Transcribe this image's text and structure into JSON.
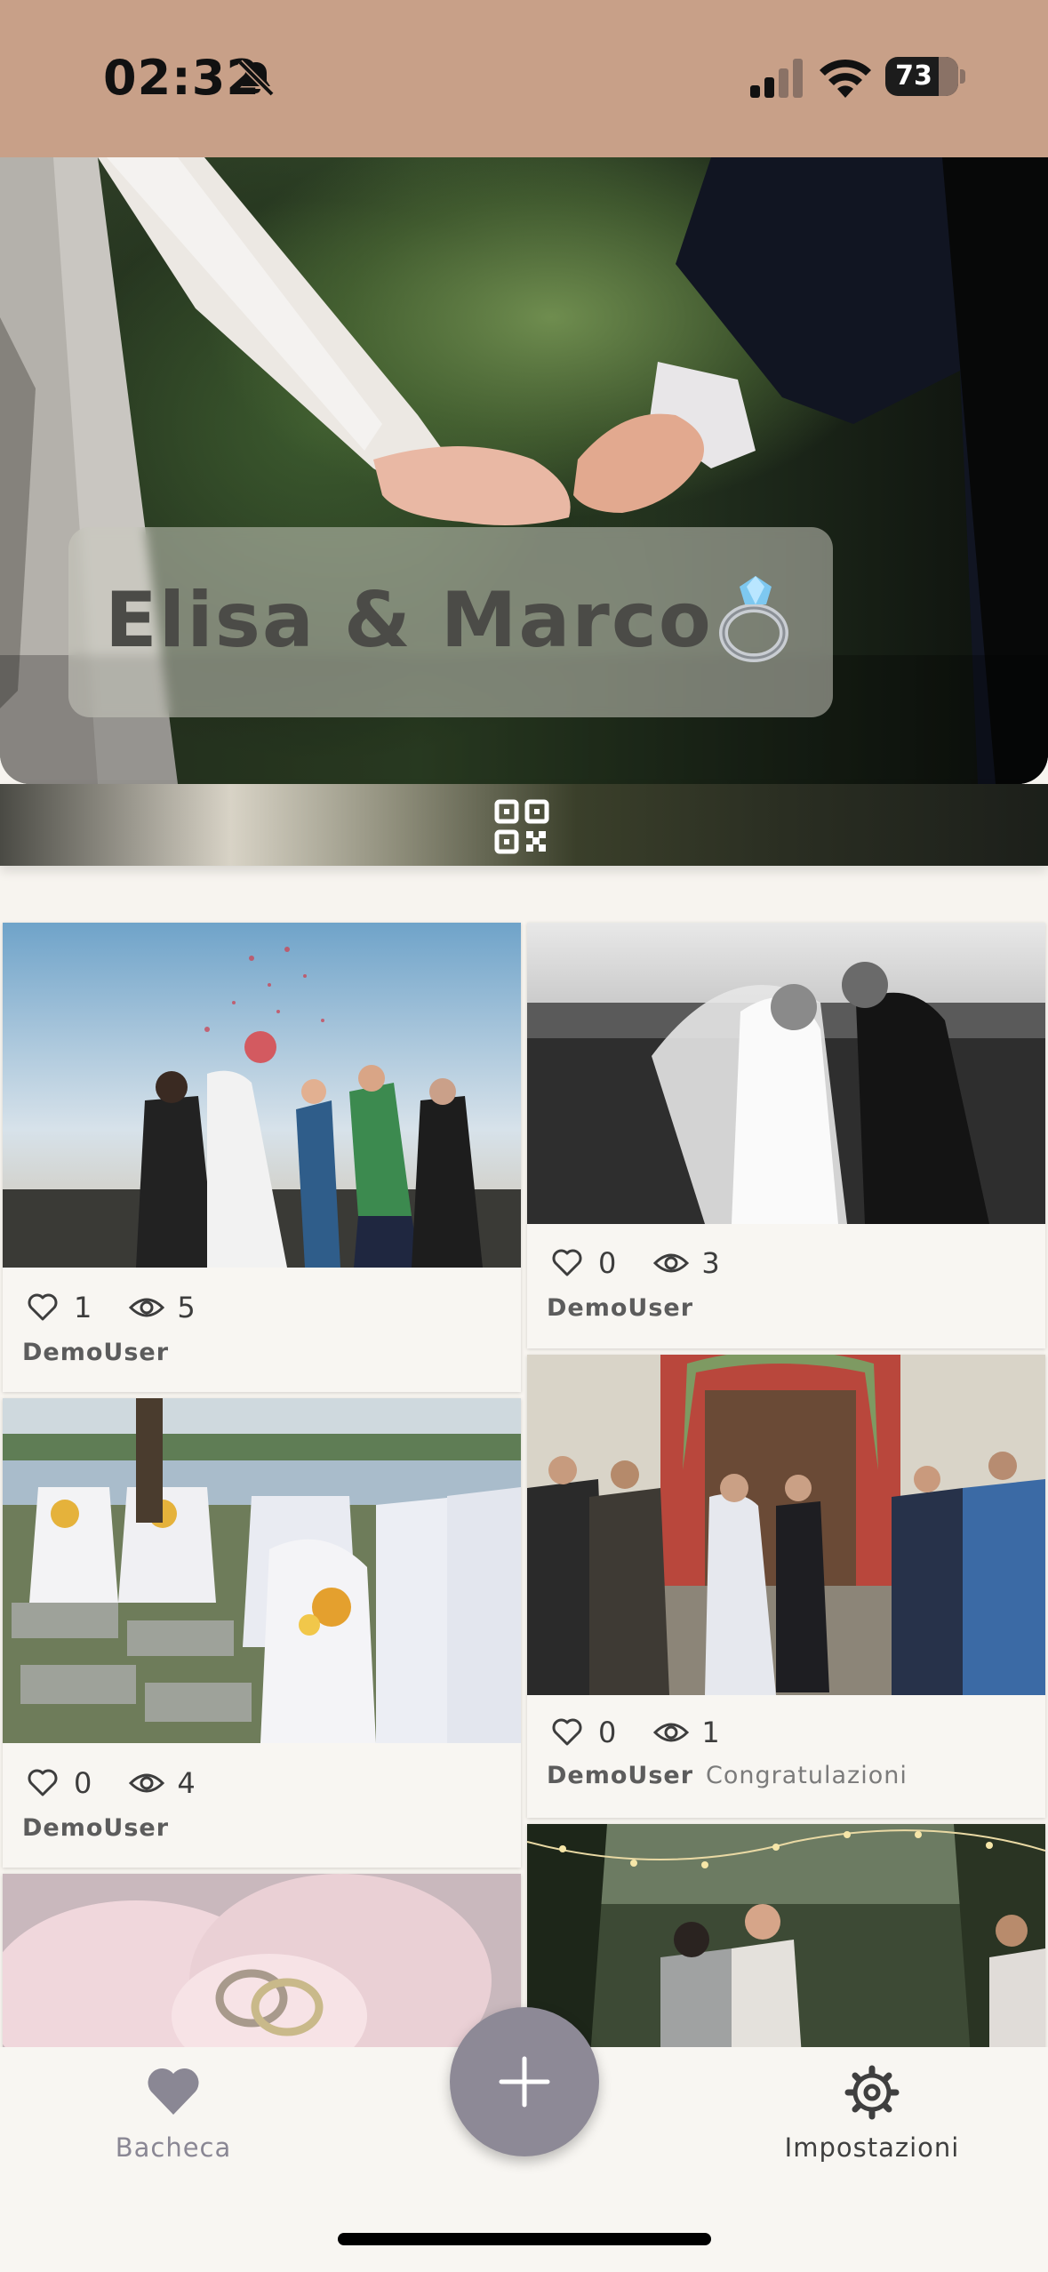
{
  "status_bar": {
    "time": "02:32",
    "battery": "73",
    "battery_level": 0.73,
    "signal_bars": 2
  },
  "header": {
    "couple_names": "Elisa & Marco",
    "title_icon": "ring-icon",
    "qr_icon": "qr-code-icon"
  },
  "posts": [
    {
      "likes": "1",
      "views": "5",
      "author": "DemoUser",
      "caption": ""
    },
    {
      "likes": "0",
      "views": "3",
      "author": "DemoUser",
      "caption": ""
    },
    {
      "likes": "0",
      "views": "4",
      "author": "DemoUser",
      "caption": ""
    },
    {
      "likes": "0",
      "views": "1",
      "author": "DemoUser",
      "caption": "Congratulazioni"
    }
  ],
  "bottom_nav": {
    "feed_label": "Bacheca",
    "feed_icon": "heart-icon",
    "add_icon": "plus-icon",
    "settings_label": "Impostazioni",
    "settings_icon": "gear-icon"
  },
  "colors": {
    "status_bar_bg": "#c8a088",
    "page_bg": "#f7f4ef",
    "card_bg": "#f8f6f2",
    "fab_bg": "#8d8996",
    "nav_icon": "#8a8794"
  }
}
